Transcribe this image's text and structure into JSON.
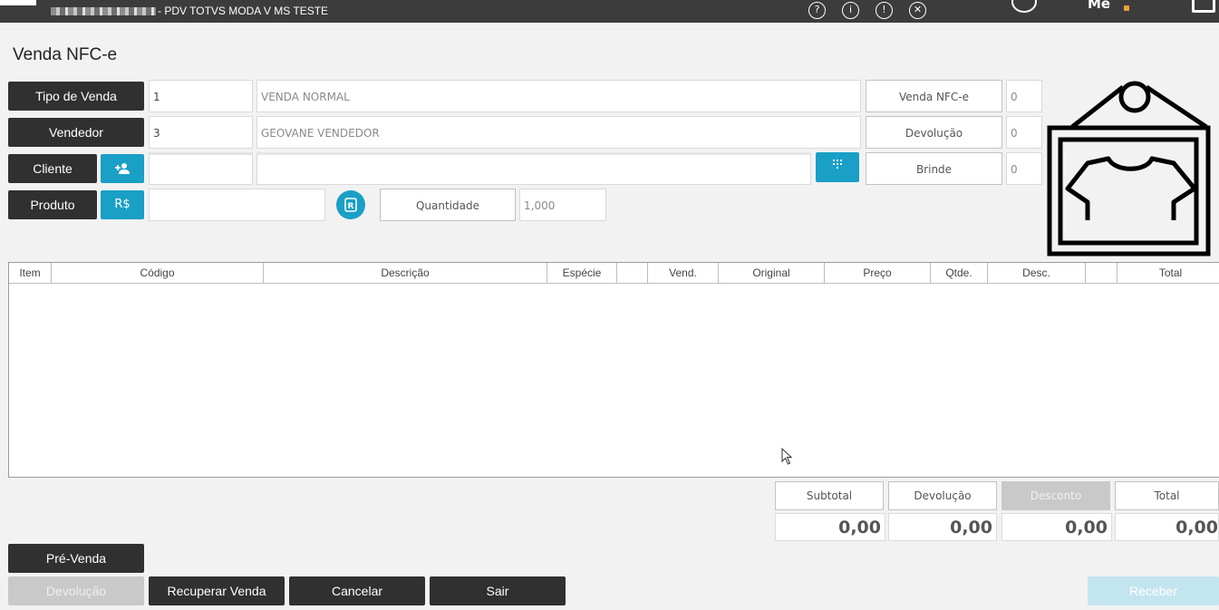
{
  "topbar": {
    "title": "- PDV TOTVS MODA V MS TESTE",
    "icons": [
      "help-icon",
      "info-icon",
      "alert-icon",
      "close-icon"
    ],
    "me_logo": "Me",
    "colors": {
      "bg": "#3c3c3c"
    }
  },
  "page": {
    "title": "Venda NFC-e"
  },
  "form": {
    "tipo_venda": {
      "label": "Tipo de Venda",
      "code": "1",
      "description": "VENDA NORMAL"
    },
    "vendedor": {
      "label": "Vendedor",
      "code": "3",
      "description": "GEOVANE VENDEDOR"
    },
    "cliente": {
      "label": "Cliente",
      "code": "",
      "description": ""
    },
    "produto": {
      "label": "Produto",
      "price_button": "R$",
      "value": ""
    },
    "quantidade": {
      "label": "Quantidade",
      "value": "1,000"
    }
  },
  "counters": [
    {
      "label": "Venda NFC-e",
      "value": "0"
    },
    {
      "label": "Devolução",
      "value": "0"
    },
    {
      "label": "Brinde",
      "value": "0"
    }
  ],
  "table": {
    "columns": [
      "Item",
      "Código",
      "Descrição",
      "Espécie",
      "",
      "Vend.",
      "Original",
      "Preço",
      "Qtde.",
      "Desc.",
      "",
      "Total"
    ],
    "rows": []
  },
  "totals": [
    {
      "label": "Subtotal",
      "value": "0,00",
      "disabled": false
    },
    {
      "label": "Devolução",
      "value": "0,00",
      "disabled": false
    },
    {
      "label": "Desconto",
      "value": "0,00",
      "disabled": true
    },
    {
      "label": "Total",
      "value": "0,00",
      "disabled": false
    }
  ],
  "actions": {
    "pre_venda": "Pré-Venda",
    "devolucao": "Devolução",
    "recuperar": "Recuperar Venda",
    "cancelar": "Cancelar",
    "sair": "Sair",
    "receber": "Receber"
  },
  "colors": {
    "accent": "#1a9fc6",
    "dark_button": "#303030",
    "disabled": "#c9c9c9"
  }
}
